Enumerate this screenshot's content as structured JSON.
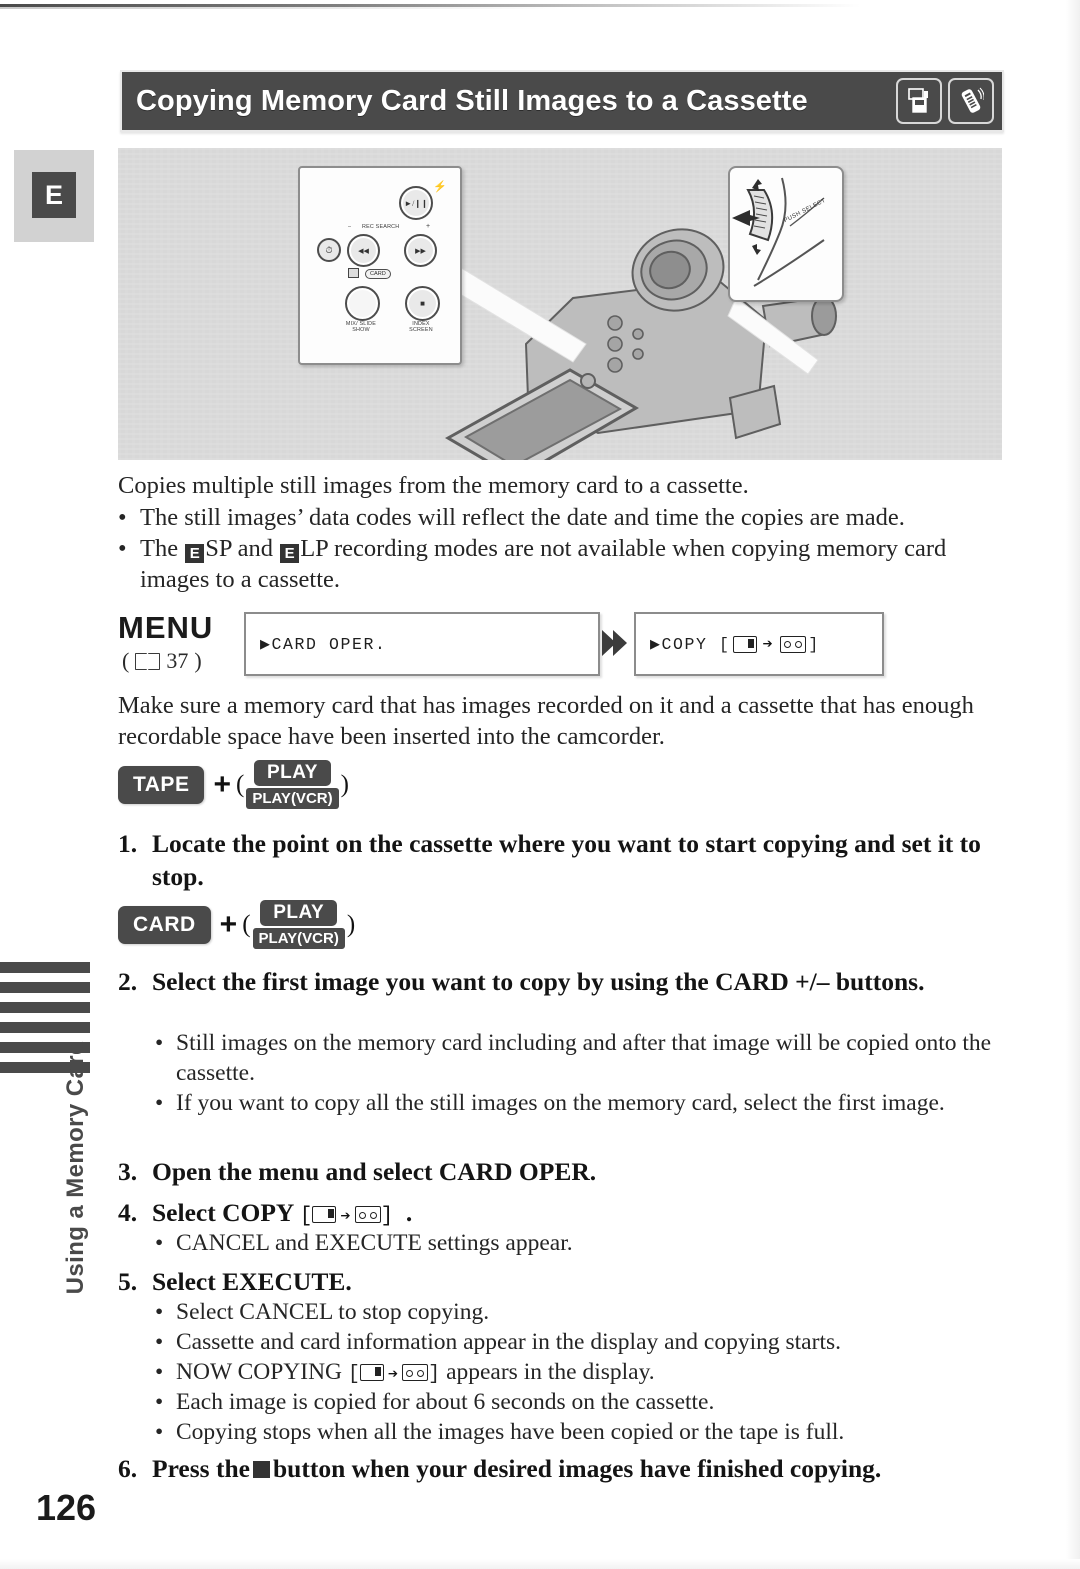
{
  "header": {
    "title": "Copying Memory Card Still Images to a Cassette",
    "icons": [
      "card-camcorder-icon",
      "remote-control-icon"
    ]
  },
  "section_tab": {
    "letter": "E",
    "vertical_label": "Using a Memory Card"
  },
  "illustration": {
    "left_callout_labels": {
      "rec_search": "REC SEARCH",
      "minus": "–",
      "plus": "+",
      "card": "CARD",
      "mix_slide_show": "MIX/\nSLIDE SHOW",
      "index_screen": "INDEX\nSCREEN",
      "play_pause": "▶/❘❘",
      "stop": "■",
      "rew": "◀◀",
      "ff": "▶▶",
      "self_timer": "⏱"
    },
    "right_callout_label": "PUSH SELECT"
  },
  "intro": "Copies multiple still images from the memory card to a cassette.",
  "intro_bullets": [
    {
      "parts": [
        {
          "type": "text",
          "value": "The still images’ data codes will reflect the date and time the copies are made."
        }
      ]
    },
    {
      "parts": [
        {
          "type": "text",
          "value": "The "
        },
        {
          "type": "badge",
          "value": "E"
        },
        {
          "type": "text",
          "value": "SP and "
        },
        {
          "type": "badge",
          "value": "E"
        },
        {
          "type": "text",
          "value": "LP recording modes are not available when copying memory card images to a cassette."
        }
      ]
    }
  ],
  "menu": {
    "word": "MENU",
    "ref_prefix": "(",
    "ref_page": "37",
    "ref_suffix": ")",
    "box1": "▶CARD OPER.",
    "box2_prefix": "▶COPY [",
    "box2_suffix": "]"
  },
  "note": "Make sure a memory card that has images recorded on it and a cassette that has enough recordable space have been inserted into the camcorder.",
  "mode_rows": [
    {
      "main": "TAPE",
      "play_top": "PLAY",
      "play_bottom": "PLAY(VCR)",
      "plus": "+",
      "open_paren": "(",
      "close_paren": ")"
    },
    {
      "main": "CARD",
      "play_top": "PLAY",
      "play_bottom": "PLAY(VCR)",
      "plus": "+",
      "open_paren": "(",
      "close_paren": ")"
    }
  ],
  "steps": [
    {
      "num": "1.",
      "text": "Locate the point on the cassette where you want to start copying and set it to stop.",
      "bullets": []
    },
    {
      "num": "2.",
      "text": "Select the first image you want to copy by using the CARD +/– buttons.",
      "bullets": [
        "Still images on the memory card including and after that image will be copied onto the cassette.",
        "If you want to copy all the still images on the memory card, select the first image."
      ]
    },
    {
      "num": "3.",
      "text": "Open the menu and select CARD OPER.",
      "bullets": []
    },
    {
      "num": "4.",
      "text": "Select COPY",
      "text_suffix": ".",
      "has_copy_icons": true,
      "bullets": [
        "CANCEL and EXECUTE settings appear."
      ]
    },
    {
      "num": "5.",
      "text": "Select EXECUTE.",
      "bullets": [
        "Select CANCEL to stop copying.",
        "Cassette and card information appear in the display and copying starts.",
        "NOW COPYING [card→tape] appears in the display.",
        "Each image is copied for about 6 seconds on the cassette.",
        "Copying stops when all the images have been copied or the tape is full."
      ]
    },
    {
      "num": "6.",
      "text": "Press the ■ button when your desired images have finished copying.",
      "bullets": []
    }
  ],
  "step5_bullet_now_copying": {
    "prefix": "NOW COPYING",
    "suffix": "appears in the display."
  },
  "step6": {
    "num": "6.",
    "before": "Press the",
    "after": "button when your desired images have finished copying."
  },
  "page_number": "126",
  "colors": {
    "ink": "#1a1a1a",
    "band": "#4a4a4a",
    "tab_gray": "#d2d2d2",
    "illustration_bg": "#d8d8d8"
  }
}
